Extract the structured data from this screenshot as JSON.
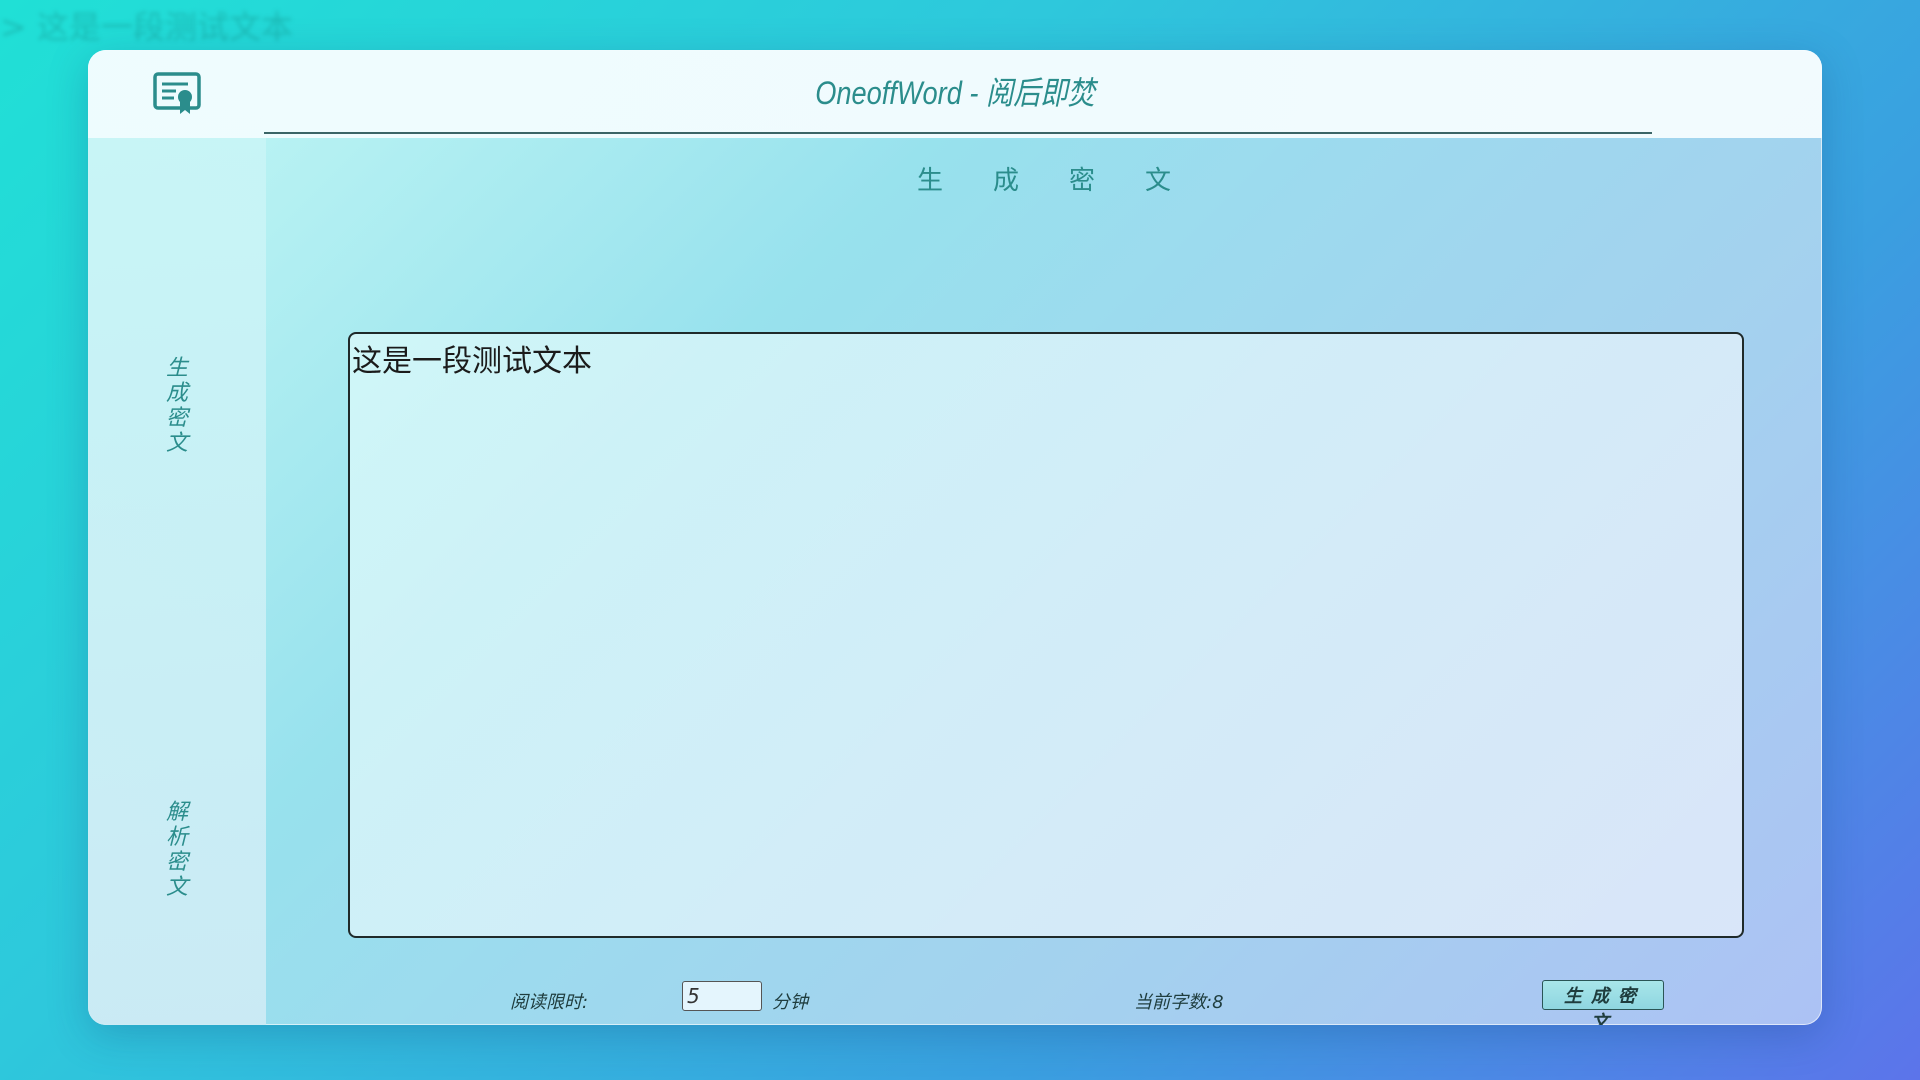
{
  "background_echo": "> 这是一段测试文本",
  "header": {
    "logo_icon": "certificate-icon",
    "title": "OneoffWord - 阅后即焚"
  },
  "sidebar": {
    "items": [
      {
        "label": "生成密文",
        "chars": [
          "生",
          "成",
          "密",
          "文"
        ]
      },
      {
        "label": "解析密文",
        "chars": [
          "解",
          "析",
          "密",
          "文"
        ]
      }
    ]
  },
  "main": {
    "section_title": "生成密文",
    "text_value": "这是一段测试文本",
    "footer": {
      "limit_label": "阅读限时:",
      "limit_value": "5",
      "limit_unit": "分钟",
      "count_text": "当前字数:8",
      "button_label": "生成密文"
    }
  },
  "colors": {
    "accent": "#2b8d8c",
    "background_start": "#20e0d6",
    "background_end": "#5c74ea"
  }
}
